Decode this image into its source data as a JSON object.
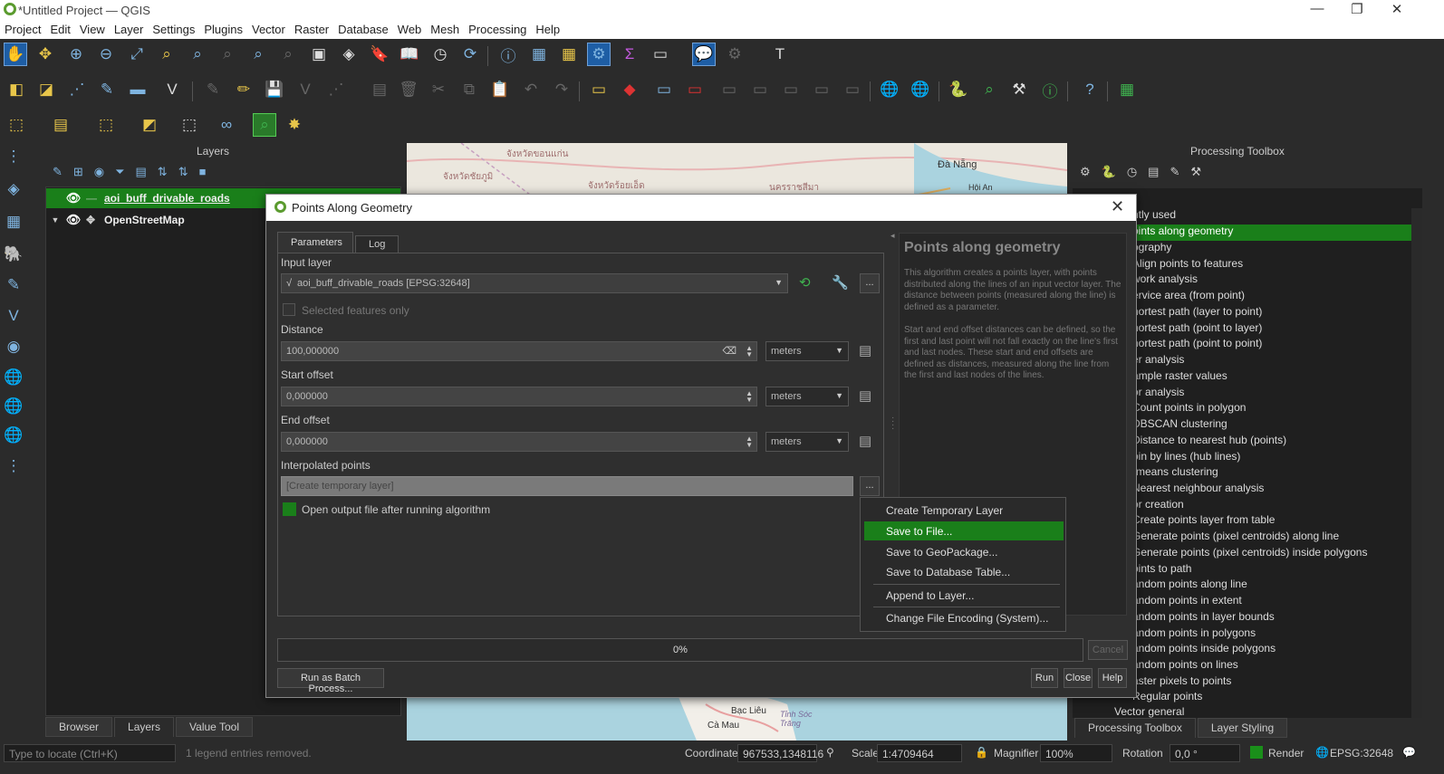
{
  "window": {
    "title": "*Untitled Project — QGIS",
    "min": "—",
    "restore": "❐",
    "close": "✕"
  },
  "menubar": [
    "Project",
    "Edit",
    "View",
    "Layer",
    "Settings",
    "Plugins",
    "Vector",
    "Raster",
    "Database",
    "Web",
    "Mesh",
    "Processing",
    "Help"
  ],
  "layers_panel": {
    "title": "Layers",
    "items": [
      {
        "name": "aoi_buff_drivable_roads"
      },
      {
        "name": "OpenStreetMap"
      }
    ],
    "bottom_tabs": [
      "Browser",
      "Layers",
      "Value Tool"
    ]
  },
  "map": {
    "labels": [
      "Đà Nẵng",
      "Hội An",
      "Bạc Liêu",
      "Cà Mau",
      "Tỉnh Sóc Trăng",
      "จังหวัดขอนแก่น",
      "จังหวัดชัยภูมิ",
      "จังหวัดร้อยเอ็ด",
      "นครราชสีมา"
    ]
  },
  "processing_panel": {
    "title": "Processing Toolbox",
    "items": [
      "ntly used",
      "oints along geometry",
      "ography",
      "Align points to features",
      "work analysis",
      "ervice area (from point)",
      "hortest path (layer to point)",
      "hortest path (point to layer)",
      "hortest path (point to point)",
      "er analysis",
      "ample raster values",
      "or analysis",
      "Count points in polygon",
      "DBSCAN clustering",
      "Distance to nearest hub (points)",
      "oin by lines (hub lines)",
      "-means clustering",
      "Nearest neighbour analysis",
      "or creation",
      "Create points layer from table",
      "Generate points (pixel centroids) along line",
      "Generate points (pixel centroids) inside polygons",
      "oints to path",
      "andom points along line",
      "andom points in extent",
      "andom points in layer bounds",
      "andom points in polygons",
      "andom points inside polygons",
      "andom points on lines",
      "aster pixels to points",
      "Regular points",
      "Vector general"
    ],
    "bottom_tabs": [
      "Processing Toolbox",
      "Layer Styling"
    ]
  },
  "dialog": {
    "title": "Points Along Geometry",
    "tabs": [
      "Parameters",
      "Log"
    ],
    "input_layer_label": "Input layer",
    "input_layer_value": "aoi_buff_drivable_roads [EPSG:32648]",
    "selected_only": "Selected features only",
    "distance_label": "Distance",
    "distance_value": "100,000000",
    "start_offset_label": "Start offset",
    "start_offset_value": "0,000000",
    "end_offset_label": "End offset",
    "end_offset_value": "0,000000",
    "unit": "meters",
    "interpolated_label": "Interpolated points",
    "interpolated_placeholder": "[Create temporary layer]",
    "open_output": "Open output file after running algorithm",
    "help_title": "Points along geometry",
    "help_p1": "This algorithm creates a points layer, with points distributed along the lines of an input vector layer. The distance between points (measured along the line) is defined as a parameter.",
    "help_p2": "Start and end offset distances can be defined, so the first and last point will not fall exactly on the line's first and last nodes. These start and end offsets are defined as distances, measured along the line from the first and last nodes of the lines.",
    "progress": "0%",
    "cancel": "Cancel",
    "batch": "Run as Batch Process...",
    "run": "Run",
    "close": "Close",
    "help": "Help",
    "dots": "...",
    "close_x": "✕"
  },
  "context_menu": [
    "Create Temporary Layer",
    "Save to File...",
    "Save to GeoPackage...",
    "Save to Database Table...",
    "Append to Layer...",
    "Change File Encoding (System)..."
  ],
  "statusbar": {
    "locate_placeholder": "Type to locate (Ctrl+K)",
    "legend_msg": "1 legend entries removed.",
    "coordinate_label": "Coordinate",
    "coordinate": "967533,1348116",
    "scale_label": "Scale",
    "scale": "1:4709464",
    "magnifier_label": "Magnifier",
    "magnifier": "100%",
    "rotation_label": "Rotation",
    "rotation": "0,0 °",
    "render_label": "Render",
    "crs": "EPSG:32648"
  }
}
